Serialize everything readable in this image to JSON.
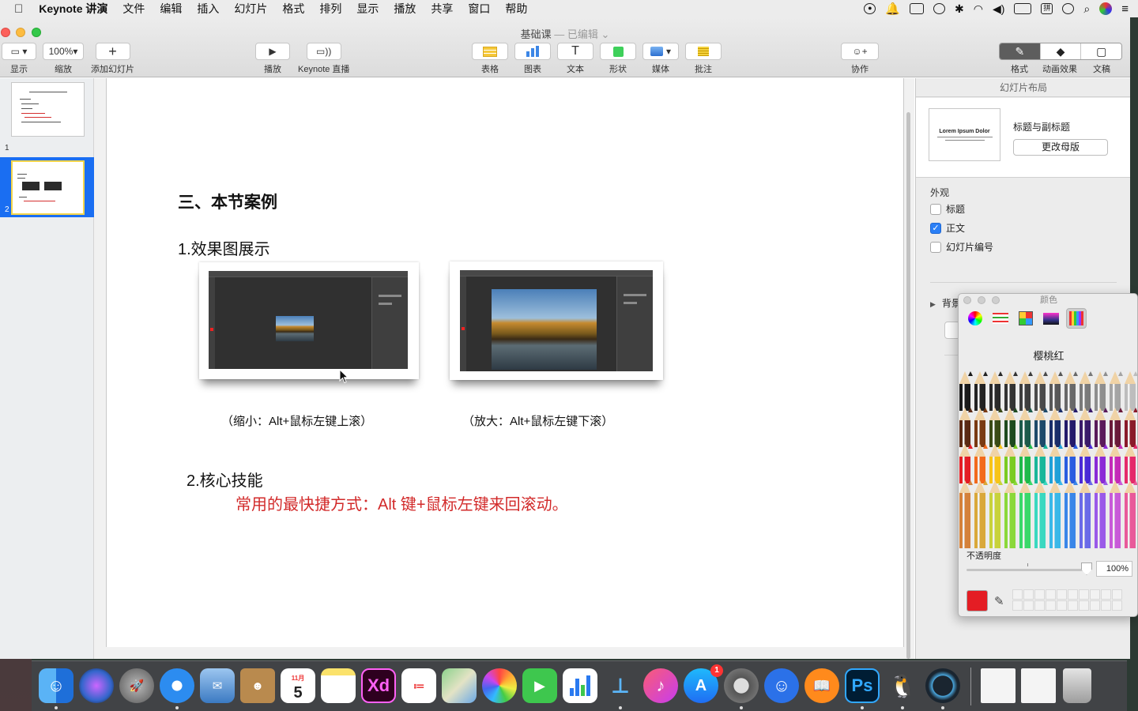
{
  "menubar": {
    "app": "Keynote 讲演",
    "items": [
      "文件",
      "编辑",
      "插入",
      "幻灯片",
      "格式",
      "排列",
      "显示",
      "播放",
      "共享",
      "窗口",
      "帮助"
    ]
  },
  "window": {
    "doc_title": "基础课",
    "doc_status": "— 已编辑",
    "toolbar": {
      "view": "显示",
      "zoom_value": "100%",
      "zoom": "缩放",
      "add_slide": "添加幻灯片",
      "play": "播放",
      "keynote_live": "Keynote 直播",
      "table": "表格",
      "chart": "图表",
      "text": "文本",
      "shape": "形状",
      "media": "媒体",
      "comment": "批注",
      "collaborate": "协作",
      "format": "格式",
      "animate": "动画效果",
      "document": "文稿"
    }
  },
  "navigator": {
    "slide_numbers": [
      "1",
      "2"
    ],
    "selected": 2
  },
  "slide": {
    "heading": "三、本节案例",
    "sub1": "1.效果图展示",
    "caption_left": "（缩小：Alt+鼠标左键上滚）",
    "caption_right": "（放大：Alt+鼠标左键下滚）",
    "sub2": "2.核心技能",
    "highlight": "常用的最快捷方式：Alt 键+鼠标左键来回滚动。"
  },
  "inspector": {
    "title": "幻灯片布局",
    "layout_preview": "Lorem Ipsum Dolor",
    "layout_name": "标题与副标题",
    "change_master": "更改母版",
    "appearance": "外观",
    "options": [
      {
        "label": "标题",
        "checked": false
      },
      {
        "label": "正文",
        "checked": true
      },
      {
        "label": "幻灯片编号",
        "checked": false
      }
    ],
    "background": "背景"
  },
  "colors_panel": {
    "title": "颜色",
    "color_name": "樱桃红",
    "opacity_label": "不透明度",
    "opacity_value": "100%",
    "current_color": "#e41d24"
  },
  "dock": {
    "apps": [
      "finder-icon",
      "siri-icon",
      "launchpad-icon",
      "safari-icon",
      "mail-icon",
      "contacts-icon",
      "calendar-icon",
      "notes-icon",
      "xd-icon",
      "reminders-icon",
      "maps-icon",
      "photos-icon",
      "facetime-icon",
      "numbers-icon",
      "keynote-icon",
      "itunes-icon",
      "appstore-icon",
      "system-preferences-icon",
      "browser-icon",
      "books-icon",
      "photoshop-icon",
      "qq-icon",
      "quicktime-icon"
    ],
    "calendar_month": "11月",
    "calendar_day": "5",
    "xd_label": "Xd",
    "ps_label": "Ps",
    "appstore_badge": "1"
  }
}
